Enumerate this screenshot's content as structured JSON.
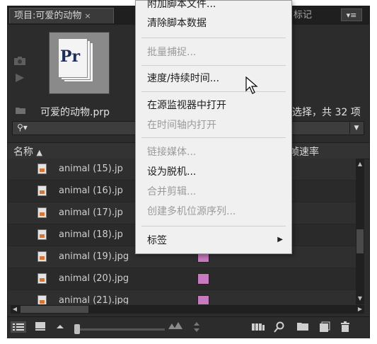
{
  "tabs": {
    "project": "项目:可爱的动物",
    "close": "×",
    "marker": "标记",
    "panel_menu": "▾≡"
  },
  "preview": {
    "thumb_logo": "Pr"
  },
  "project_name": "可爱的动物.prp",
  "selection_info": "选择，共 32 项",
  "search": {
    "icon": "⚲▾",
    "dropdown": "▼"
  },
  "columns": {
    "name": "名称",
    "sort": "▲",
    "frame_rate": "帧速率"
  },
  "rows": [
    {
      "name": "animal (15).jp",
      "swatch": ""
    },
    {
      "name": "animal (16).jp",
      "swatch": ""
    },
    {
      "name": "animal (17).jp",
      "swatch": ""
    },
    {
      "name": "animal (18).jp",
      "swatch": ""
    },
    {
      "name": "animal (19).jpg",
      "swatch": "#c77ac0"
    },
    {
      "name": "animal (20).jpg",
      "swatch": "#c77ac0"
    },
    {
      "name": "animal (21).jpg",
      "swatch": "#c77ac0"
    }
  ],
  "context_menu": {
    "items": [
      {
        "label": "附加脚本文件...",
        "enabled": true
      },
      {
        "label": "清除脚本数据",
        "enabled": true
      },
      {
        "label": "批量捕捉...",
        "enabled": false
      },
      {
        "label": "速度/持续时间...",
        "enabled": true
      },
      {
        "label": "在源监视器中打开",
        "enabled": true
      },
      {
        "label": "在时间轴内打开",
        "enabled": false
      },
      {
        "label": "链接媒体...",
        "enabled": false
      },
      {
        "label": "设为脱机...",
        "enabled": true
      },
      {
        "label": "合并剪辑...",
        "enabled": false
      },
      {
        "label": "创建多机位源序列...",
        "enabled": false
      },
      {
        "label": "标签",
        "enabled": true,
        "submenu": true
      }
    ]
  },
  "scroll": {
    "up": "▲",
    "down": "▼",
    "left": "◀",
    "right": "▶"
  },
  "toolbar_icons": [
    "list-view-icon",
    "icon-view-icon",
    "zoom-out-icon",
    "zoom-slider",
    "zoom-in-icon",
    "sort-icon",
    "bin-icon",
    "find-icon",
    "new-bin-icon",
    "new-item-icon",
    "trash-icon"
  ],
  "colors": {
    "panel_bg": "#2c2c2c",
    "menu_bg": "#f0f0f0",
    "label_violet": "#c77ac0"
  }
}
